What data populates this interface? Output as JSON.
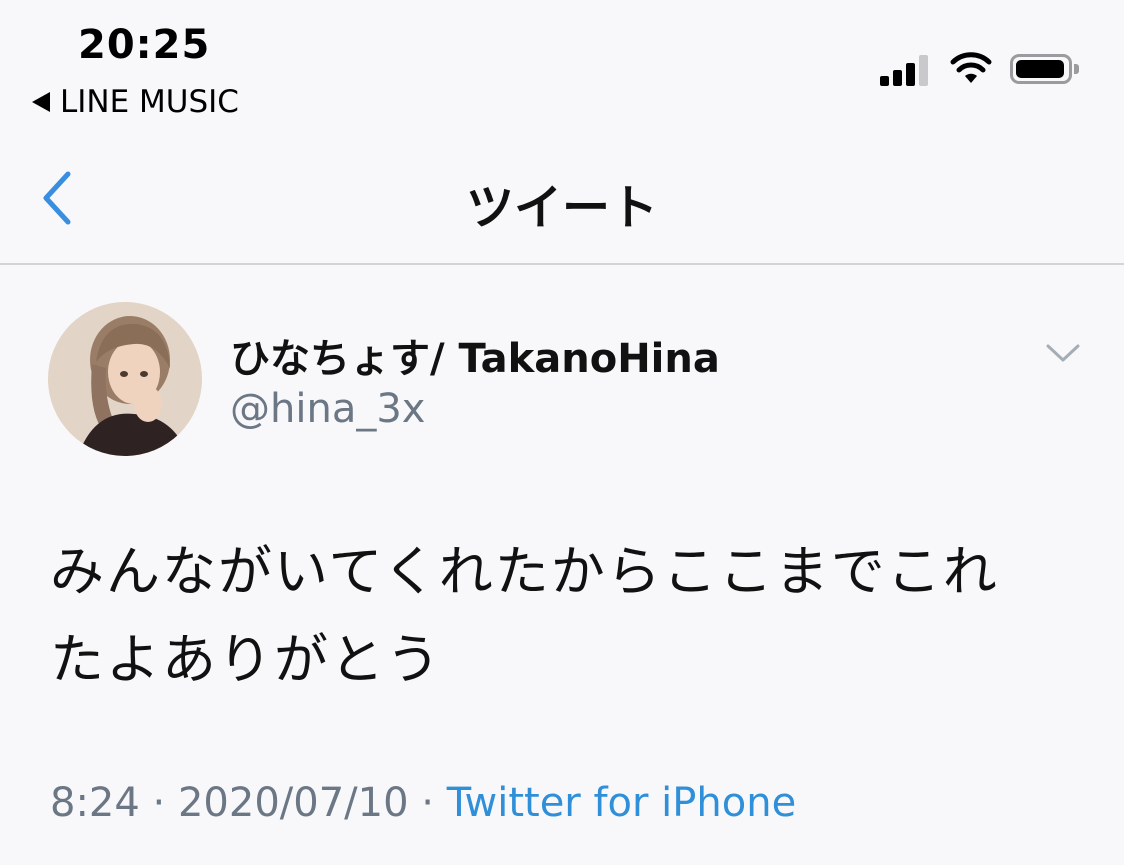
{
  "status_bar": {
    "time": "20:25",
    "back_app_label": "LINE MUSIC",
    "icons": [
      "signal-icon",
      "wifi-icon",
      "battery-icon"
    ]
  },
  "nav": {
    "title": "ツイート",
    "back_icon": "chevron-left-icon"
  },
  "tweet": {
    "display_name": "ひなちょす/ TakanoHina",
    "handle": "@hina_3x",
    "body": "みんながいてくれたからここまでこれたよありがとう",
    "time": "8:24",
    "separator": " · ",
    "date": "2020/07/10",
    "source": "Twitter for iPhone",
    "menu_icon": "chevron-down-icon"
  },
  "colors": {
    "accent": "#2f8fd8",
    "secondary_text": "#6b7785",
    "background": "#f8f8fa",
    "divider": "#d3d3d8"
  }
}
